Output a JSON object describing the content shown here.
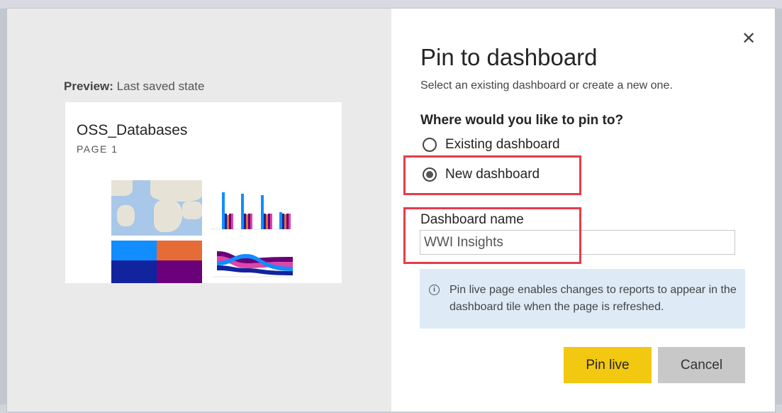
{
  "dialog": {
    "title": "Pin to dashboard",
    "subtitle": "Select an existing dashboard or create a new one.",
    "close_icon": "close-icon"
  },
  "preview": {
    "label_bold": "Preview:",
    "label_rest": " Last saved state",
    "card_title": "OSS_Databases",
    "card_page": "PAGE 1"
  },
  "question": "Where would you like to pin to?",
  "options": {
    "existing": "Existing dashboard",
    "new": "New dashboard",
    "selected": "new"
  },
  "name_field": {
    "label": "Dashboard name",
    "value": "WWI Insights"
  },
  "info": {
    "icon": "info-icon",
    "text": "Pin live page enables changes to reports to appear in the dashboard tile when the page is refreshed."
  },
  "buttons": {
    "pin": "Pin live",
    "cancel": "Cancel"
  },
  "colors": {
    "primary_button": "#f2c811",
    "secondary_button": "#c8c8c8",
    "highlight": "#e43d4a",
    "info_background": "#deebf7"
  }
}
